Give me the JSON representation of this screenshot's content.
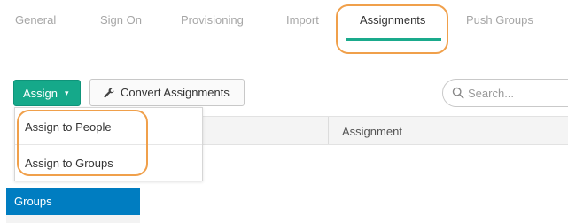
{
  "tabs": [
    {
      "label": "General"
    },
    {
      "label": "Sign On"
    },
    {
      "label": "Provisioning"
    },
    {
      "label": "Import"
    },
    {
      "label": "Assignments",
      "active": true
    },
    {
      "label": "Push Groups"
    }
  ],
  "toolbar": {
    "assign_label": "Assign",
    "assign_caret": "▾",
    "convert_label": "Convert Assignments",
    "search_placeholder": "Search..."
  },
  "dropdown": {
    "items": [
      {
        "label": "Assign to People"
      },
      {
        "label": "Assign to Groups"
      }
    ]
  },
  "table": {
    "columns": [
      "Assignment"
    ]
  },
  "sidebar": {
    "items": [
      {
        "label": "Groups",
        "selected": true
      }
    ]
  },
  "colors": {
    "accent": "#15a98a",
    "selected": "#007dc1",
    "highlight": "#f0a04b"
  },
  "icons": {
    "convert": "wrench-icon",
    "search": "search-icon",
    "assign_caret": "caret-down-icon"
  }
}
